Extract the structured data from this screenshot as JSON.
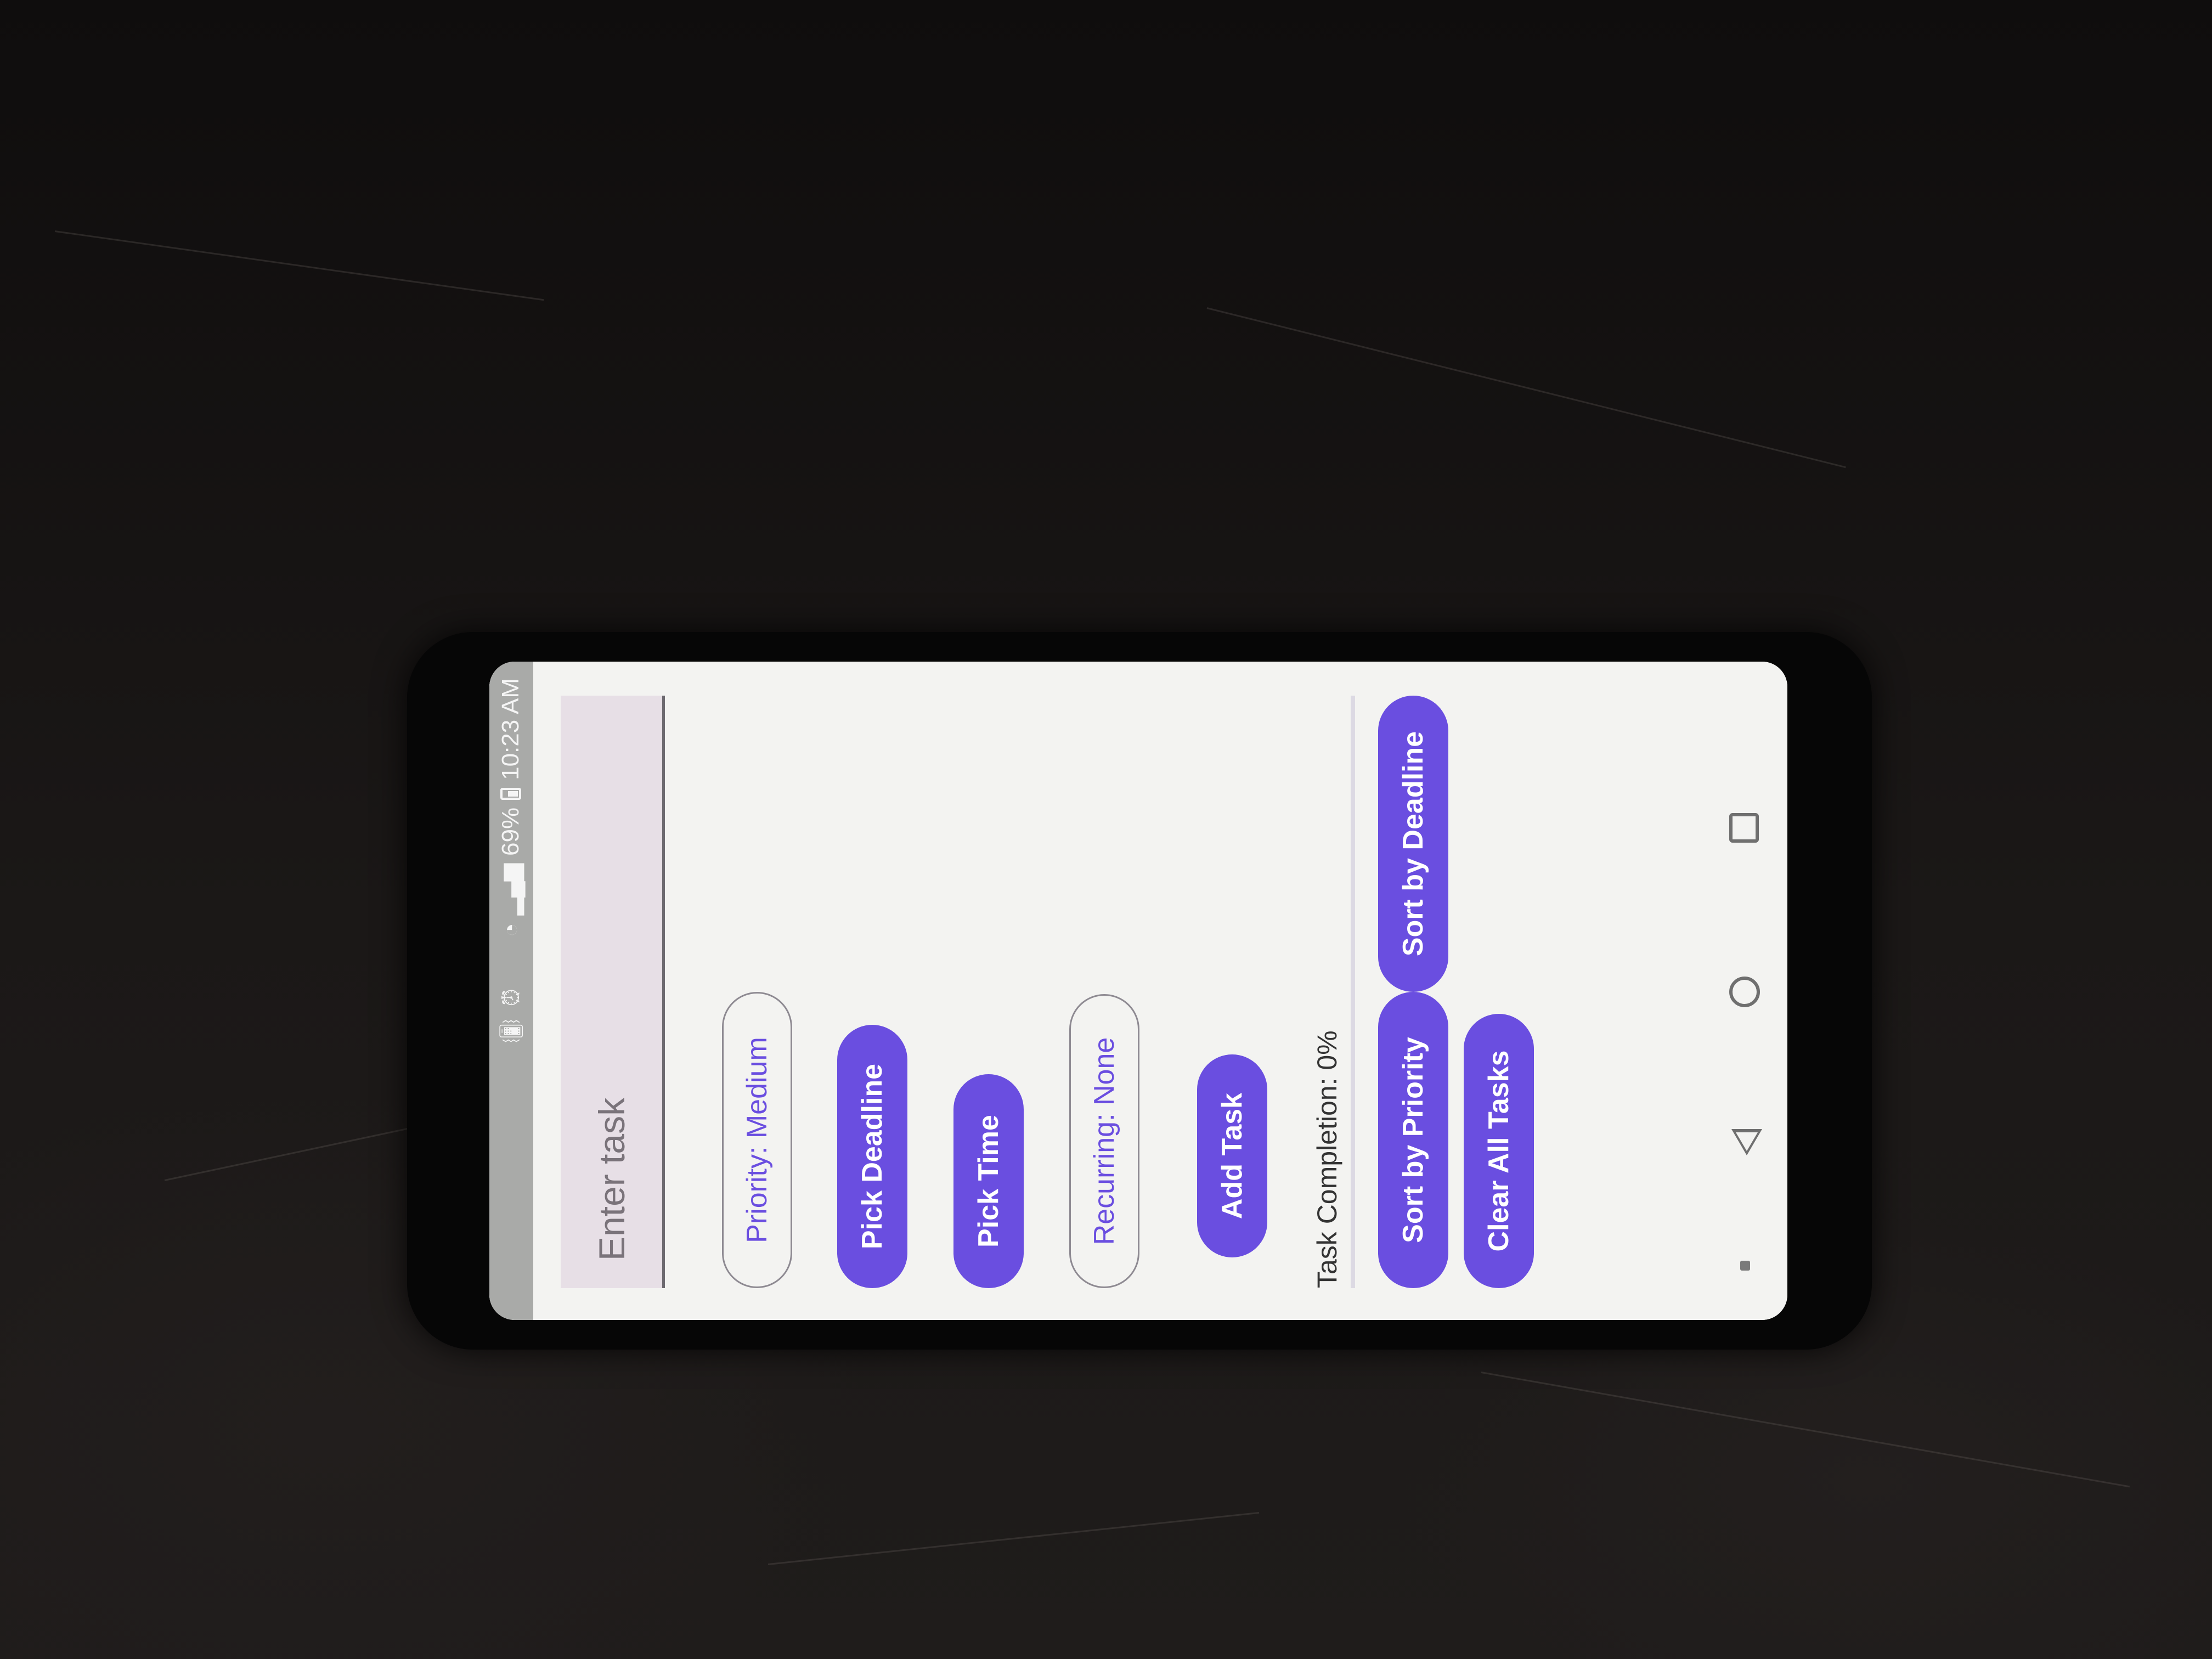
{
  "status_bar": {
    "time": "10:23 AM",
    "battery": "69%",
    "icons": [
      "vibrate-icon",
      "alarm-icon",
      "wifi-icon",
      "signal-icon",
      "battery-icon"
    ]
  },
  "task_input": {
    "placeholder": "Enter task",
    "value": ""
  },
  "buttons": {
    "priority": "Priority: Medium",
    "pick_deadline": "Pick Deadline",
    "pick_time": "Pick Time",
    "recurring": "Recurring: None",
    "add_task": "Add Task",
    "sort_by_priority": "Sort by Priority",
    "sort_by_deadline": "Sort by Deadline",
    "clear_all": "Clear All Tasks"
  },
  "completion": {
    "label": "Task Completion: 0%",
    "progress": 0
  },
  "nav_bar": {
    "icons": [
      "back-icon",
      "home-icon",
      "recents-icon"
    ]
  },
  "colors": {
    "accent": "#6a4ee0",
    "input_bg": "#e7dfe6",
    "screen_bg": "#f3f3f1",
    "status_bar": "#a9aaa8"
  }
}
